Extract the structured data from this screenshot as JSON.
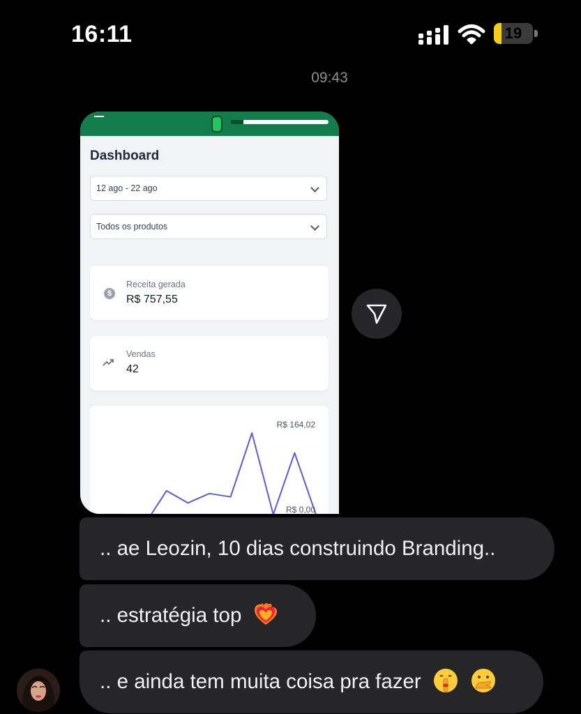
{
  "status_bar": {
    "time": "16:11",
    "battery_level": "19",
    "battery_fraction": 0.19,
    "battery_color": "#f4cc1c",
    "signal_icon": "cellular-signal-icon",
    "wifi_icon": "wifi-icon"
  },
  "chat": {
    "timestamp": "09:43",
    "shared_post": {
      "dashboard_title": "Dashboard",
      "date_range": "12 ago - 22 ago",
      "product_filter": "Todos os produtos",
      "revenue_label": "Receita gerada",
      "revenue_value": "R$ 757,55",
      "sales_label": "Vendas",
      "sales_value": "42",
      "chart_data": {
        "type": "line",
        "x": [
          1,
          2,
          3,
          4,
          5,
          6,
          7,
          8,
          9,
          10,
          11
        ],
        "y": [
          16.5,
          16.5,
          0,
          59.5,
          37.5,
          54.5,
          48.5,
          164.02,
          16.5,
          128,
          16.5
        ],
        "ylim": [
          0,
          164.02
        ],
        "ytick_labels": [
          "R$ 164,02",
          "R$ 0,00"
        ],
        "line_color": "#5b5bd6",
        "grid": false
      },
      "brand_color": "#127d4a"
    },
    "share_icon": "paper-plane-icon",
    "messages": [
      {
        "text": ".. ae Leozin, 10 dias construindo Branding..",
        "emoji": ""
      },
      {
        "text": ".. estratégia top",
        "emoji": "heart-on-fire-emoji"
      },
      {
        "text": ".. e ainda tem muita coisa pra fazer",
        "emoji": "shushing-face-and-hand-over-mouth-emoji"
      }
    ],
    "sender_avatar": "sender-avatar"
  }
}
